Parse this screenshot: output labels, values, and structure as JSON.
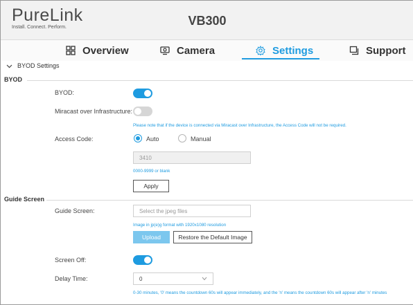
{
  "header": {
    "logo_text": "PureLink",
    "logo_tagline": "Install. Connect. Perform.",
    "device_title": "VB300"
  },
  "nav": {
    "tabs": [
      {
        "label": "Overview",
        "icon": "grid-icon",
        "active": false
      },
      {
        "label": "Camera",
        "icon": "camera-icon",
        "active": false
      },
      {
        "label": "Settings",
        "icon": "gear-icon",
        "active": true
      },
      {
        "label": "Support",
        "icon": "support-icon",
        "active": false
      }
    ]
  },
  "section": {
    "title": "BYOD Settings"
  },
  "byod": {
    "group_label": "BYOD",
    "byod_label": "BYOD:",
    "byod_enabled": true,
    "miracast_label": "Miracast over Infrastructure:",
    "miracast_enabled": false,
    "miracast_note": "Please note that if the device is connected via Miracast over Infrastructure, the Access Code will not be required.",
    "access_code_label": "Access Code:",
    "access_code_options": [
      "Auto",
      "Manual"
    ],
    "access_code_selected": "Auto",
    "access_code_value": "3410",
    "access_code_hint": "0000-9999 or blank",
    "apply_label": "Apply"
  },
  "guide": {
    "group_label": "Guide Screen",
    "guide_label": "Guide Screen:",
    "file_placeholder": "Select the jpeg files",
    "file_hint": "Image in jp(e)g format with 1920x1080 resolution",
    "upload_label": "Upload",
    "restore_label": "Restore the Default Image",
    "screen_off_label": "Screen Off:",
    "screen_off_enabled": true,
    "delay_label": "Delay Time:",
    "delay_value": "0",
    "delay_note": "0-30 minutes, '0' means the countdown 60s will appear immediately, and the 'n' means the countdown 60s will appear after 'n' minutes"
  },
  "colors": {
    "accent": "#1e9be0",
    "upload_button": "#7cc7ee",
    "toggle_off": "#d6d6d6"
  }
}
